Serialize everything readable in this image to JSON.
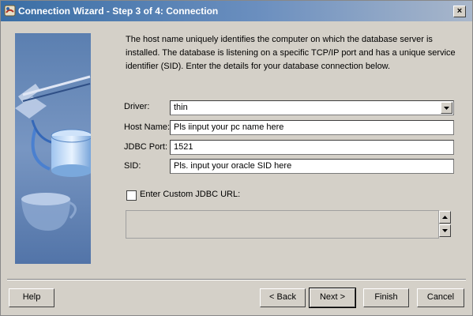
{
  "window": {
    "title": "Connection Wizard - Step 3 of 4: Connection",
    "close_label": "×"
  },
  "intro_text": "The host name uniquely identifies the computer on which the database server is installed.  The database is listening on a specific TCP/IP port and has a unique service identifier (SID).  Enter the details for your database connection below.",
  "form": {
    "driver": {
      "label": "Driver:",
      "value": "thin"
    },
    "host": {
      "label": "Host Name:",
      "value": "Pls iinput your pc name here"
    },
    "port": {
      "label": "JDBC Port:",
      "value": "1521"
    },
    "sid": {
      "label": "SID:",
      "value": "Pls. input your oracle SID here"
    }
  },
  "custom_url": {
    "label": "Enter Custom JDBC URL:",
    "checked": false,
    "value": ""
  },
  "buttons": {
    "help": "Help",
    "back": "< Back",
    "next": "Next >",
    "finish": "Finish",
    "cancel": "Cancel"
  },
  "colors": {
    "title_gradient_start": "#3a6ea5",
    "title_gradient_end": "#a9b7cb",
    "dialog_bg": "#d4d0c8",
    "side_image_bg": "#5b7fb0"
  }
}
